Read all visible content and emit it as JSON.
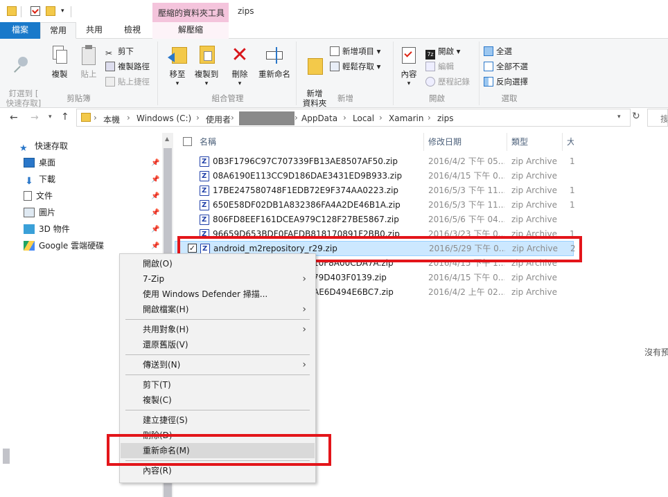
{
  "window": {
    "title": "zips",
    "context_tab_title": "壓縮的資料夾工具"
  },
  "tabs": {
    "file": "檔案",
    "home": "常用",
    "share": "共用",
    "view": "檢視",
    "ctx": "解壓縮"
  },
  "ribbon": {
    "clipboard": {
      "label": "剪貼簿",
      "pin": "釘選到 [\n快速存取]",
      "copy": "複製",
      "paste": "貼上",
      "cut": "剪下",
      "copy_path": "複製路徑",
      "paste_shortcut": "貼上捷徑"
    },
    "organize": {
      "label": "組合管理",
      "move_to": "移至",
      "copy_to": "複製到",
      "delete": "刪除",
      "rename": "重新命名"
    },
    "new": {
      "label": "新增",
      "new_folder": "新增\n資料夾",
      "new_item": "新增項目",
      "easy_access": "輕鬆存取"
    },
    "open": {
      "label": "開啟",
      "properties": "內容",
      "open": "開啟",
      "edit": "編輯",
      "history": "歷程記錄"
    },
    "select": {
      "label": "選取",
      "select_all": "全選",
      "select_none": "全部不選",
      "invert": "反向選擇"
    }
  },
  "address": {
    "crumbs": [
      "本機",
      "Windows (C:)",
      "使用者",
      "",
      "AppData",
      "Local",
      "Xamarin",
      "zips"
    ],
    "search_placeholder": "搜"
  },
  "nav": {
    "items": [
      {
        "label": "快速存取",
        "icon": "star-icon"
      },
      {
        "label": "桌面",
        "icon": "desktop-icon"
      },
      {
        "label": "下載",
        "icon": "download-icon"
      },
      {
        "label": "文件",
        "icon": "document-icon"
      },
      {
        "label": "圖片",
        "icon": "picture-icon"
      },
      {
        "label": "3D 物件",
        "icon": "cube-icon"
      },
      {
        "label": "Google 雲端硬碟",
        "icon": "drive-icon"
      }
    ]
  },
  "columns": {
    "name": "名稱",
    "date": "修改日期",
    "type": "類型",
    "size": "大"
  },
  "files": [
    {
      "name": "0B3F1796C97C707339FB13AE8507AF50.zip",
      "date": "2016/4/2 下午 05...",
      "type": "zip Archive",
      "size": "1"
    },
    {
      "name": "08A6190E113CC9D186DAE3431ED9B933.zip",
      "date": "2016/4/15 下午 0...",
      "type": "zip Archive",
      "size": ""
    },
    {
      "name": "17BE247580748F1EDB72E9F374AA0223.zip",
      "date": "2016/5/3 下午 11...",
      "type": "zip Archive",
      "size": "1"
    },
    {
      "name": "650E58DF02DB1A832386FA4A2DE46B1A.zip",
      "date": "2016/5/3 下午 11...",
      "type": "zip Archive",
      "size": "1"
    },
    {
      "name": "806FD8EEF161DCEA979C128F27BE5867.zip",
      "date": "2016/5/6 下午 04...",
      "type": "zip Archive",
      "size": ""
    },
    {
      "name": "96659D653BDF0FAEDB818170891F2BB0.zip",
      "date": "2016/3/23 下午 0...",
      "type": "zip Archive",
      "size": "1"
    },
    {
      "name": "android_m2repository_r29.zip",
      "date": "2016/5/29 下午 0...",
      "type": "zip Archive",
      "size": "2"
    },
    {
      "name": "10F8A00CDA7A.zip",
      "date": "2016/4/15 下午 1...",
      "type": "zip Archive",
      "size": ""
    },
    {
      "name": "79D403F0139.zip",
      "date": "2016/4/15 下午 0...",
      "type": "zip Archive",
      "size": ""
    },
    {
      "name": "AE6D494E6BC7.zip",
      "date": "2016/4/2 上午 02...",
      "type": "zip Archive",
      "size": ""
    }
  ],
  "empty_preview": "沒有預",
  "context_menu": [
    {
      "label": "開啟(O)",
      "bold": true
    },
    {
      "label": "7-Zip",
      "arrow": true
    },
    {
      "label": "使用 Windows Defender 掃描..."
    },
    {
      "label": "開啟檔案(H)",
      "arrow": true
    },
    {
      "label": "共用對象(H)",
      "arrow": true
    },
    {
      "label": "還原舊版(V)"
    },
    {
      "label": "傳送到(N)",
      "arrow": true
    },
    {
      "label": "剪下(T)"
    },
    {
      "label": "複製(C)"
    },
    {
      "label": "建立捷徑(S)"
    },
    {
      "label": "刪除(D)"
    },
    {
      "label": "重新命名(M)",
      "highlight": true
    },
    {
      "label": "內容(R)"
    }
  ]
}
